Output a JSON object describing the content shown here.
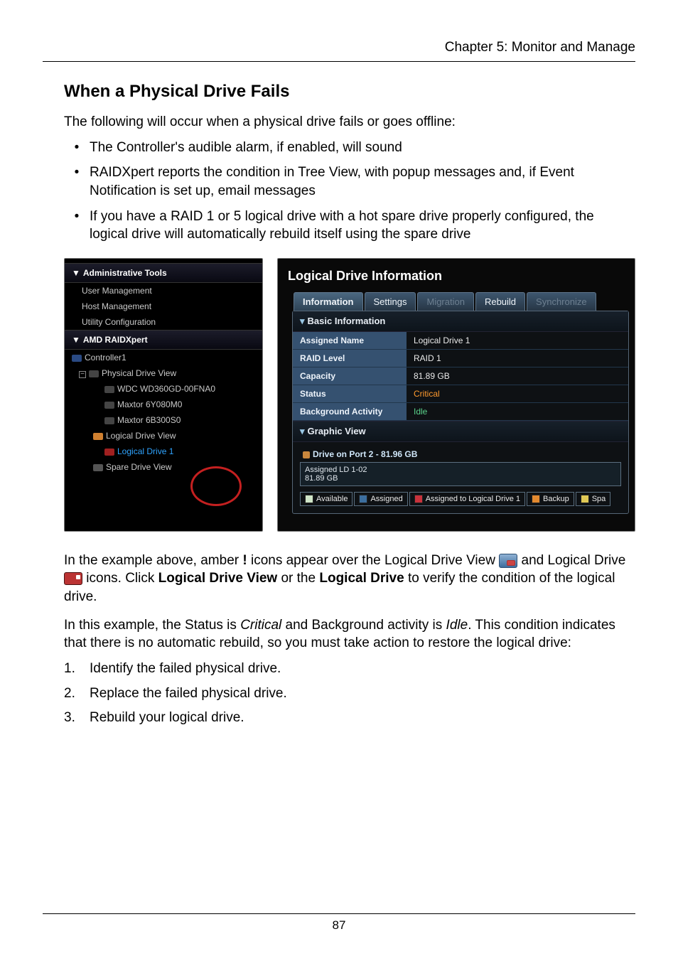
{
  "chapter": "Chapter 5: Monitor and Manage",
  "heading": "When a Physical Drive Fails",
  "intro": "The following will occur when a physical drive fails or goes offline:",
  "bullets": [
    "The Controller's audible alarm, if enabled, will sound",
    "RAIDXpert reports the condition in Tree View, with popup messages and, if Event Notification is set up, email messages",
    "If you have a RAID 1 or 5 logical drive with a hot spare drive properly configured, the logical drive will automatically rebuild itself using the spare drive"
  ],
  "tree": {
    "admin_header": "Administrative Tools",
    "admin_items": [
      "User Management",
      "Host Management",
      "Utility Configuration"
    ],
    "raid_header": "AMD RAIDXpert",
    "controller": "Controller1",
    "pdv": "Physical Drive View",
    "drives": [
      "WDC WD360GD-00FNA0",
      "Maxtor 6Y080M0",
      "Maxtor 6B300S0"
    ],
    "ldv": "Logical Drive View",
    "ld1": "Logical Drive 1",
    "sdv": "Spare Drive View"
  },
  "panel": {
    "title": "Logical Drive Information",
    "tabs": {
      "info": "Information",
      "settings": "Settings",
      "migration": "Migration",
      "rebuild": "Rebuild",
      "sync": "Synchronize"
    },
    "basic": "Basic Information",
    "rows": {
      "assigned_name_k": "Assigned Name",
      "assigned_name_v": "Logical Drive 1",
      "raid_level_k": "RAID Level",
      "raid_level_v": "RAID 1",
      "capacity_k": "Capacity",
      "capacity_v": "81.89 GB",
      "status_k": "Status",
      "status_v": "Critical",
      "bg_k": "Background Activity",
      "bg_v": "Idle"
    },
    "graphic": "Graphic View",
    "port_label": "Drive on Port 2 - 81.96 GB",
    "bar_line1": "Assigned LD 1-02",
    "bar_line2": "81.89 GB",
    "legend": {
      "available": "Available",
      "assigned": "Assigned",
      "assigned_ld": "Assigned to Logical Drive 1",
      "backup": "Backup",
      "spa": "Spa"
    }
  },
  "after": {
    "p1a": "In the example above, amber ",
    "p1b": "!",
    "p1c": " icons appear over the Logical Drive View ",
    "p2a": "and Logical Drive ",
    "p2b": " icons. Click ",
    "p2c": "Logical Drive View",
    "p2d": " or the ",
    "p2e": "Logical Drive",
    "p2f": " to verify the condition of the logical drive.",
    "p3a": "In this example, the Status is ",
    "p3b": "Critical",
    "p3c": " and Background activity is ",
    "p3d": "Idle",
    "p3e": ". This condition indicates that there is no automatic rebuild, so you must take action to restore the logical drive:"
  },
  "steps": [
    "Identify the failed physical drive.",
    "Replace the failed physical drive.",
    "Rebuild your logical drive."
  ],
  "page_number": "87"
}
